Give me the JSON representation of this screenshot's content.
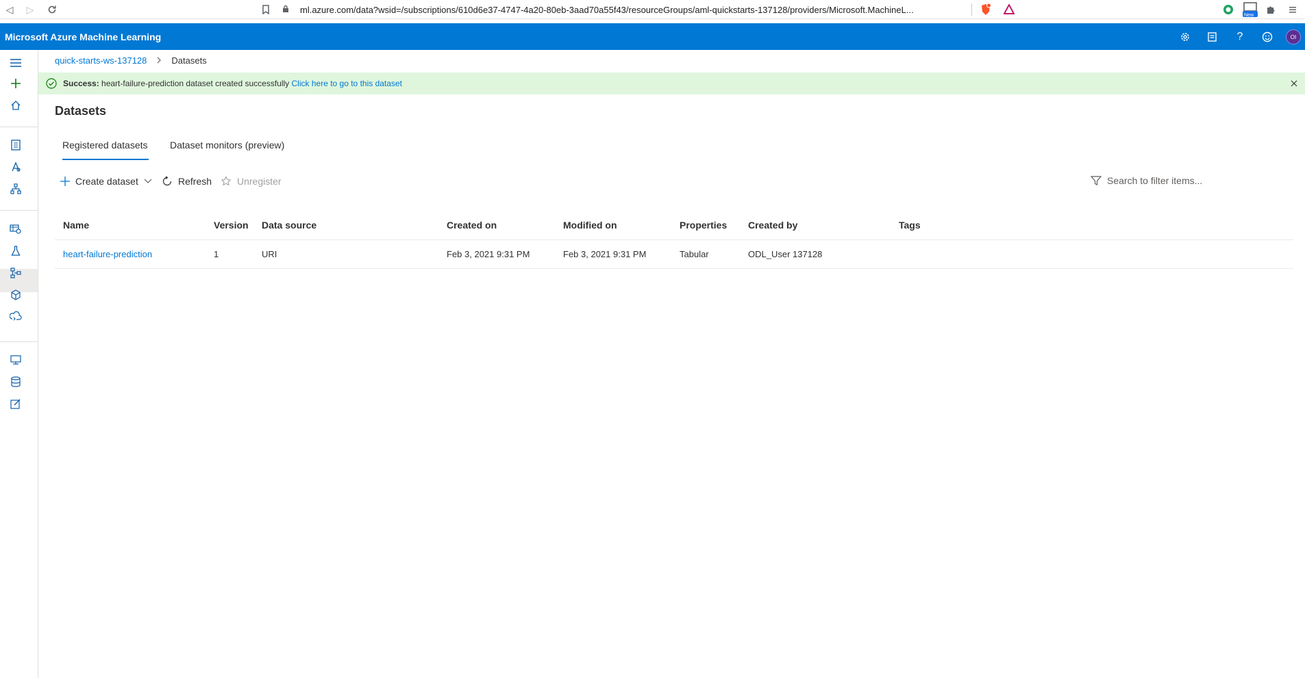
{
  "browser": {
    "url": "ml.azure.com/data?wsid=/subscriptions/610d6e37-4747-4a20-80eb-3aad70a55f43/resourceGroups/aml-quickstarts-137128/providers/Microsoft.MachineL...",
    "ext_badge_new": "New"
  },
  "header": {
    "title": "Microsoft Azure Machine Learning",
    "avatar_initials": "OI"
  },
  "breadcrumb": {
    "workspace": "quick-starts-ws-137128",
    "current": "Datasets"
  },
  "banner": {
    "label": "Success:",
    "message": " heart-failure-prediction dataset created successfully ",
    "link": "Click here to go to this dataset"
  },
  "page": {
    "title": "Datasets"
  },
  "tabs": [
    {
      "label": "Registered datasets"
    },
    {
      "label": "Dataset monitors (preview)"
    }
  ],
  "toolbar": {
    "create": "Create dataset",
    "refresh": "Refresh",
    "unregister": "Unregister",
    "filter_placeholder": "Search to filter items..."
  },
  "table": {
    "columns": [
      "Name",
      "Version",
      "Data source",
      "Created on",
      "Modified on",
      "Properties",
      "Created by",
      "Tags"
    ],
    "rows": [
      {
        "name": "heart-failure-prediction",
        "version": "1",
        "data_source": "URI",
        "created_on": "Feb 3, 2021 9:31 PM",
        "modified_on": "Feb 3, 2021 9:31 PM",
        "properties": "Tabular",
        "created_by": "ODL_User 137128",
        "tags": ""
      }
    ]
  },
  "colors": {
    "accent": "#0078d4",
    "success_bg": "#dff6dd",
    "success_icon": "#107c10"
  }
}
